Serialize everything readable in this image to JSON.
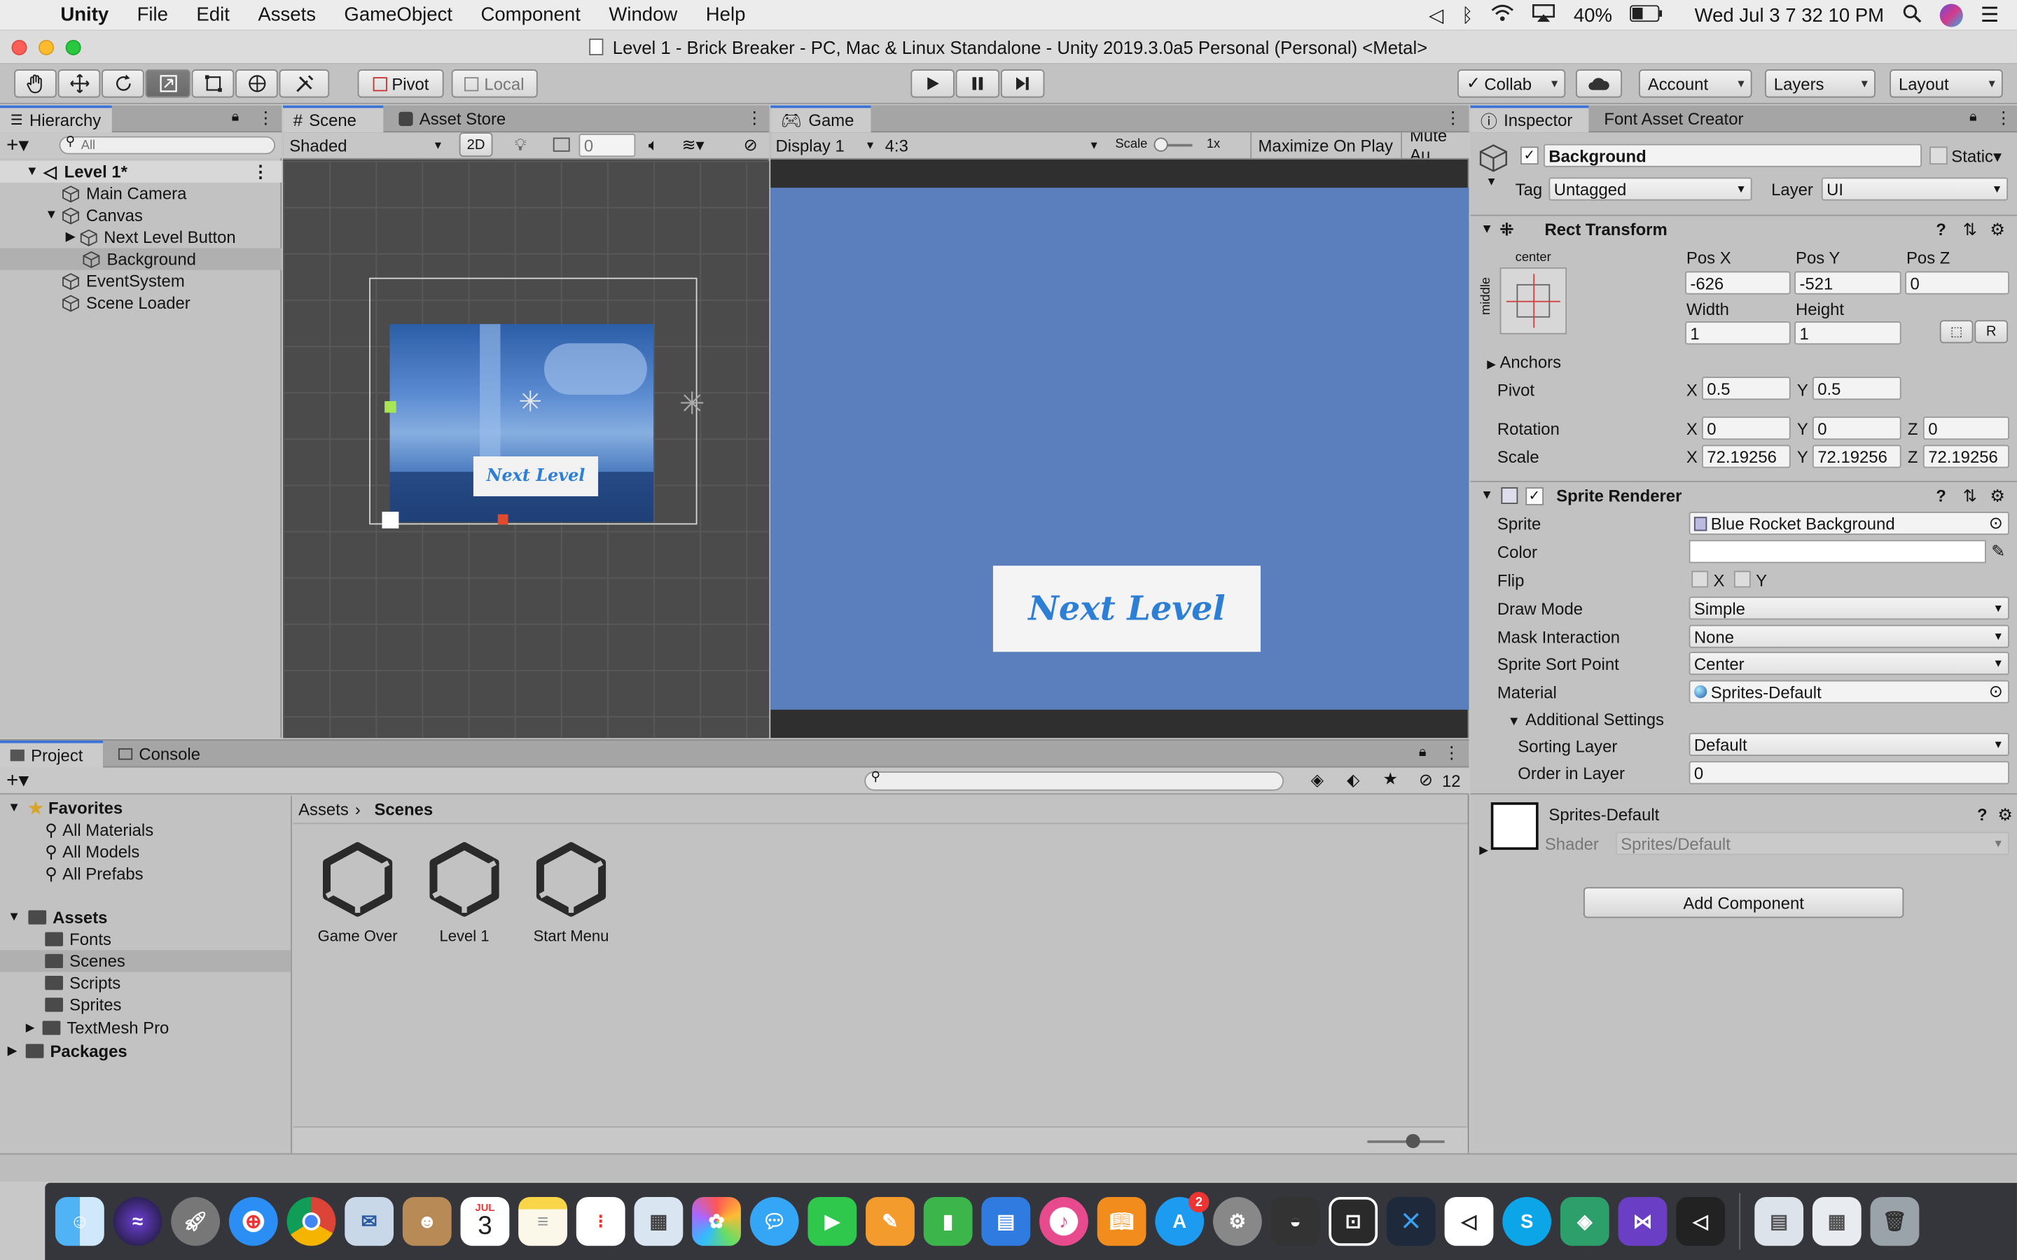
{
  "menubar": {
    "app": "Unity",
    "items": [
      "File",
      "Edit",
      "Assets",
      "GameObject",
      "Component",
      "Window",
      "Help"
    ],
    "battery": "40%",
    "clock": "Wed Jul 3  7 32 10 PM"
  },
  "window": {
    "title": "Level 1 - Brick Breaker - PC, Mac & Linux Standalone - Unity 2019.3.0a5 Personal (Personal) <Metal>"
  },
  "toolbar": {
    "pivot": "Pivot",
    "local": "Local",
    "collab": "Collab",
    "account": "Account",
    "layers": "Layers",
    "layout": "Layout"
  },
  "hierarchy": {
    "tab": "Hierarchy",
    "search_placeholder": "All",
    "scene": "Level 1*",
    "items": [
      {
        "label": "Main Camera"
      },
      {
        "label": "Canvas"
      },
      {
        "label": "Next Level Button"
      },
      {
        "label": "Background"
      },
      {
        "label": "EventSystem"
      },
      {
        "label": "Scene Loader"
      }
    ]
  },
  "scene_view": {
    "tab": "Scene",
    "tab2": "Asset Store",
    "shading": "Shaded",
    "mode_2d": "2D",
    "gizmo_count": "0",
    "button_text": "Next Level"
  },
  "game_view": {
    "tab": "Game",
    "display": "Display 1",
    "aspect": "4:3",
    "scale_label": "Scale",
    "scale_value": "1x",
    "maximize": "Maximize On Play",
    "mute": "Mute Au",
    "button_text": "Next Level",
    "bg_color": "#5b7fbd"
  },
  "inspector": {
    "tab": "Inspector",
    "tab2": "Font Asset Creator",
    "object_name": "Background",
    "static_label": "Static",
    "tag_label": "Tag",
    "tag_value": "Untagged",
    "layer_label": "Layer",
    "layer_value": "UI",
    "rect_transform": {
      "title": "Rect Transform",
      "anchor_h": "center",
      "anchor_v": "middle",
      "pos_x_label": "Pos X",
      "pos_x": "-626",
      "pos_y_label": "Pos Y",
      "pos_y": "-521",
      "pos_z_label": "Pos Z",
      "pos_z": "0",
      "width_label": "Width",
      "width": "1",
      "height_label": "Height",
      "height": "1",
      "r_button": "R",
      "anchors": "Anchors",
      "pivot_label": "Pivot",
      "pivot_x": "0.5",
      "pivot_y": "0.5",
      "rotation_label": "Rotation",
      "rot_x": "0",
      "rot_y": "0",
      "rot_z": "0",
      "scale_label": "Scale",
      "scale_x": "72.19256",
      "scale_y": "72.19256",
      "scale_z": "72.19256",
      "x": "X",
      "y": "Y",
      "z": "Z"
    },
    "sprite_renderer": {
      "title": "Sprite Renderer",
      "sprite_label": "Sprite",
      "sprite": "Blue Rocket Background",
      "color_label": "Color",
      "flip_label": "Flip",
      "flip_x": "X",
      "flip_y": "Y",
      "draw_mode_label": "Draw Mode",
      "draw_mode": "Simple",
      "mask_label": "Mask Interaction",
      "mask": "None",
      "sort_point_label": "Sprite Sort Point",
      "sort_point": "Center",
      "material_label": "Material",
      "material": "Sprites-Default",
      "additional": "Additional Settings",
      "sorting_layer_label": "Sorting Layer",
      "sorting_layer": "Default",
      "order_label": "Order in Layer",
      "order": "0"
    },
    "material_block": {
      "name": "Sprites-Default",
      "shader_label": "Shader",
      "shader": "Sprites/Default"
    },
    "add_component": "Add Component"
  },
  "project": {
    "tab": "Project",
    "tab2": "Console",
    "hidden_count": "12",
    "favorites": "Favorites",
    "fav_items": [
      "All Materials",
      "All Models",
      "All Prefabs"
    ],
    "assets": "Assets",
    "folders": [
      "Fonts",
      "Scenes",
      "Scripts",
      "Sprites",
      "TextMesh Pro"
    ],
    "packages": "Packages",
    "breadcrumb_root": "Assets",
    "breadcrumb_current": "Scenes",
    "files": [
      "Game Over",
      "Level 1",
      "Start Menu"
    ]
  },
  "dock": {
    "calendar_month": "JUL",
    "calendar_day": "3",
    "appstore_badge": "2"
  }
}
